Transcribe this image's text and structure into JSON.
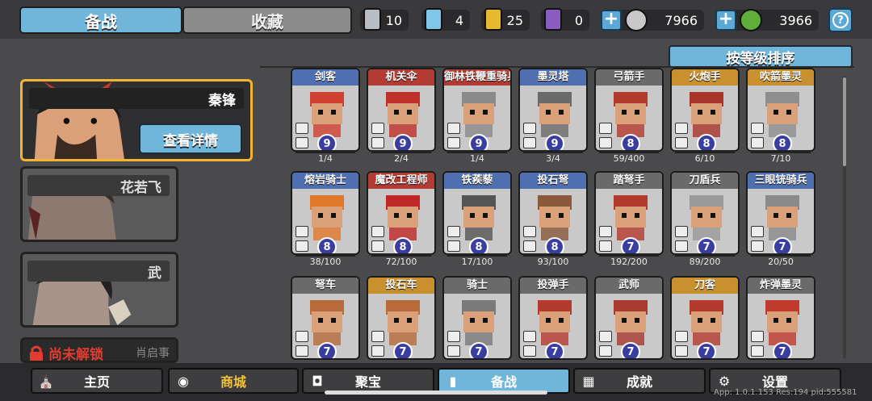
{
  "top_tabs": {
    "active": "备战",
    "inactive": "收藏"
  },
  "resources": [
    {
      "icon": "silver-shield-icon",
      "value": "10",
      "color": "#b8bcc4"
    },
    {
      "icon": "crystal-shield-icon",
      "value": "4",
      "color": "#7ec7e8"
    },
    {
      "icon": "gold-shield-icon",
      "value": "25",
      "color": "#e8b92c"
    },
    {
      "icon": "purple-shield-icon",
      "value": "0",
      "color": "#8a5cc0"
    }
  ],
  "currency": {
    "silver_coin": "7966",
    "jade_coin": "3966"
  },
  "sort_label": "按等级排序",
  "heroes": {
    "selected": {
      "name": "秦锋",
      "detail_button": "查看详情"
    },
    "second": {
      "name": "花若飞"
    },
    "third": {
      "name": "武"
    },
    "locked": {
      "label": "尚未解锁",
      "sub": "肖启事"
    }
  },
  "units": [
    {
      "name": "剑客",
      "level": "9",
      "progress": "1/4",
      "fill": 0.25,
      "cat": "cat-blue",
      "art": "#d04030"
    },
    {
      "name": "机关伞",
      "level": "9",
      "progress": "2/4",
      "fill": 0.5,
      "cat": "cat-red",
      "art": "#c0302a"
    },
    {
      "name": "御林铁鞭重骑兵",
      "level": "9",
      "progress": "1/4",
      "fill": 0.25,
      "cat": "cat-red",
      "art": "#8a8a8a"
    },
    {
      "name": "墨灵塔",
      "level": "9",
      "progress": "3/4",
      "fill": 0.75,
      "cat": "cat-blue",
      "art": "#6a6a6a"
    },
    {
      "name": "弓箭手",
      "level": "8",
      "progress": "59/400",
      "fill": 0.15,
      "cat": "cat-gray",
      "art": "#b53a2e"
    },
    {
      "name": "火炮手",
      "level": "8",
      "progress": "6/10",
      "fill": 0.6,
      "cat": "cat-gold",
      "art": "#a8342a"
    },
    {
      "name": "吹箭墨灵",
      "level": "8",
      "progress": "7/10",
      "fill": 0.7,
      "cat": "cat-gold",
      "art": "#8e8e8e"
    },
    {
      "name": "熔岩骑士",
      "level": "8",
      "progress": "38/100",
      "fill": 0.38,
      "cat": "cat-blue",
      "art": "#e0782a"
    },
    {
      "name": "魔改工程师",
      "level": "8",
      "progress": "72/100",
      "fill": 0.72,
      "cat": "cat-red",
      "art": "#c02828"
    },
    {
      "name": "铁蒺藜",
      "level": "8",
      "progress": "17/100",
      "fill": 0.17,
      "cat": "cat-blue",
      "art": "#555555"
    },
    {
      "name": "投石弩",
      "level": "8",
      "progress": "93/100",
      "fill": 0.93,
      "cat": "cat-blue",
      "art": "#8a5a3a"
    },
    {
      "name": "踏弩手",
      "level": "7",
      "progress": "192/200",
      "fill": 0.96,
      "cat": "cat-gray",
      "art": "#b53a2e"
    },
    {
      "name": "刀盾兵",
      "level": "7",
      "progress": "89/200",
      "fill": 0.45,
      "cat": "cat-gray",
      "art": "#9a9a9a"
    },
    {
      "name": "三眼铳骑兵",
      "level": "7",
      "progress": "20/50",
      "fill": 0.4,
      "cat": "cat-blue",
      "art": "#8a8a8a"
    },
    {
      "name": "弩车",
      "level": "7",
      "progress": "",
      "fill": 0.0,
      "cat": "cat-gray",
      "art": "#b86a3a"
    },
    {
      "name": "投石车",
      "level": "7",
      "progress": "",
      "fill": 0.0,
      "cat": "cat-gold",
      "art": "#b86a3a"
    },
    {
      "name": "骑士",
      "level": "7",
      "progress": "",
      "fill": 0.0,
      "cat": "cat-gray",
      "art": "#7a7a7a"
    },
    {
      "name": "投弹手",
      "level": "7",
      "progress": "",
      "fill": 0.0,
      "cat": "cat-gray",
      "art": "#b53a2e"
    },
    {
      "name": "武师",
      "level": "7",
      "progress": "",
      "fill": 0.0,
      "cat": "cat-gray",
      "art": "#a83a30"
    },
    {
      "name": "刀客",
      "level": "7",
      "progress": "",
      "fill": 0.0,
      "cat": "cat-gold",
      "art": "#b53a2e"
    },
    {
      "name": "炸弹墨灵",
      "level": "7",
      "progress": "",
      "fill": 0.0,
      "cat": "cat-gray",
      "art": "#c03a2e"
    }
  ],
  "nav": [
    {
      "label": "主页",
      "icon": "castle-icon"
    },
    {
      "label": "商城",
      "icon": "coins-icon"
    },
    {
      "label": "聚宝",
      "icon": "treasure-bowl-icon"
    },
    {
      "label": "备战",
      "icon": "cards-icon"
    },
    {
      "label": "成就",
      "icon": "achievements-icon"
    },
    {
      "label": "设置",
      "icon": "gear-icon"
    }
  ],
  "app_version": "App: 1.0.1.153 Res:194 pid:555581"
}
